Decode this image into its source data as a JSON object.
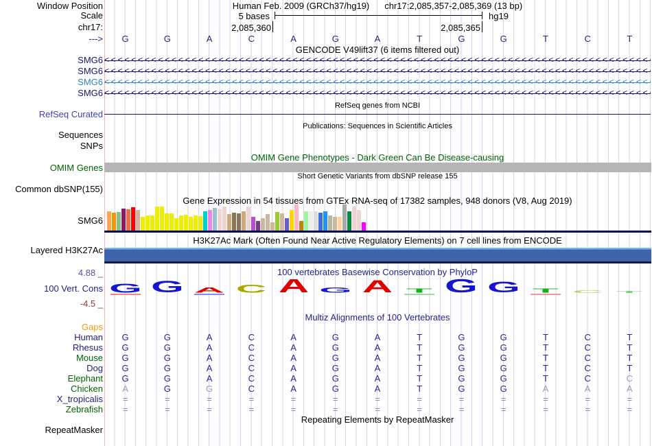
{
  "header": {
    "assembly_title": "Human Feb. 2009 (GRCh37/hg19)",
    "position_title": "chr17:2,085,357-2,085,369 (13 bp)",
    "window_position_label": "Window Position",
    "scale_label": "Scale",
    "scale_value": "5 bases",
    "assembly_tag": "hg19",
    "chrom_label": "chr17:",
    "coord_left": "2,085,360",
    "coord_right": "2,085,365",
    "strand_arrow": "--->"
  },
  "sequence": {
    "bases": [
      "G",
      "G",
      "A",
      "C",
      "A",
      "G",
      "A",
      "T",
      "G",
      "G",
      "T",
      "C",
      "T"
    ],
    "color": "#28286e"
  },
  "tracks": {
    "gencode": {
      "title": "GENCODE V49lift37 (6 items filtered out)",
      "genes": [
        {
          "label": "SMG6",
          "color": "#12126b"
        },
        {
          "label": "SMG6",
          "color": "#12126b"
        },
        {
          "label": "SMG6",
          "color": "#3080c8"
        },
        {
          "label": "SMG6",
          "color": "#12126b"
        }
      ]
    },
    "refseq": {
      "title": "RefSeq genes from NCBI",
      "label": "RefSeq Curated",
      "line_color": "#12126b"
    },
    "publications": {
      "title": "Publications: Sequences in Scientific Articles",
      "label": "Sequences"
    },
    "snps": {
      "label": "SNPs"
    },
    "omim": {
      "title": "OMIM Gene Phenotypes - Dark Green Can Be Disease-causing",
      "label": "OMIM Genes",
      "bar_color": "#b5b5b5"
    },
    "dbsnp": {
      "title": "Short Genetic Variants from dbSNP release 155",
      "label": "Common dbSNP(155)"
    },
    "gtex": {
      "label": "SMG6",
      "baseline_color": "#0a0a50"
    },
    "h3k27ac": {
      "title": "H3K27Ac Mark (Often Found Near Active Regulatory Elements) on 7 cell lines from ENCODE",
      "label": "Layered H3K27Ac",
      "bar_top": "#7fb2ee",
      "bar_body": "#3d64ad",
      "bar_bottom": "#131a45"
    },
    "phylop": {
      "title": "100 vertebrates Basewise Conservation by PhyloP",
      "label": "100 Vert. Cons",
      "max_label": "4.88 _",
      "min_label": "-4.5 _",
      "base_colors": {
        "A": "#e00000",
        "C": "#a8a800",
        "G": "#1515d0",
        "T": "#15b015"
      },
      "logo": [
        {
          "base": "G",
          "h": 13,
          "uline": "#ee8888"
        },
        {
          "base": "G",
          "h": 17
        },
        {
          "base": "A",
          "h": 8,
          "uline": "#8888ee"
        },
        {
          "base": "C",
          "h": 12
        },
        {
          "base": "A",
          "h": 20
        },
        {
          "base": "G",
          "h": 8
        },
        {
          "base": "A",
          "h": 18
        },
        {
          "base": "T",
          "h": 6,
          "uline": "#99dd99"
        },
        {
          "base": "G",
          "h": 20
        },
        {
          "base": "G",
          "h": 16
        },
        {
          "base": "T",
          "h": 6,
          "uline": "#ee9999"
        },
        {
          "base": "C",
          "h": 4,
          "faint": true
        },
        {
          "base": "T",
          "h": 3,
          "faint": true
        }
      ]
    },
    "multiz": {
      "title": "Multiz Alignments of 100 Vertebrates",
      "gaps_label": "Gaps",
      "rows": [
        {
          "species": "Human",
          "label_color": "#1e1e78",
          "bases": [
            "G",
            "G",
            "A",
            "C",
            "A",
            "G",
            "A",
            "T",
            "G",
            "G",
            "T",
            "C",
            "T"
          ],
          "gray": []
        },
        {
          "species": "Rhesus",
          "label_color": "#1e1e78",
          "bases": [
            "G",
            "G",
            "A",
            "C",
            "A",
            "G",
            "A",
            "T",
            "G",
            "G",
            "T",
            "C",
            "T"
          ],
          "gray": []
        },
        {
          "species": "Mouse",
          "label_color": "#006400",
          "bases": [
            "G",
            "G",
            "A",
            "C",
            "A",
            "G",
            "A",
            "T",
            "G",
            "G",
            "T",
            "C",
            "T"
          ],
          "gray": []
        },
        {
          "species": "Dog",
          "label_color": "#1e1e78",
          "bases": [
            "G",
            "G",
            "A",
            "C",
            "A",
            "G",
            "A",
            "T",
            "G",
            "G",
            "T",
            "C",
            "T"
          ],
          "gray": []
        },
        {
          "species": "Elephant",
          "label_color": "#006400",
          "bases": [
            "G",
            "G",
            "A",
            "C",
            "A",
            "G",
            "A",
            "T",
            "G",
            "G",
            "T",
            "C",
            "C"
          ],
          "gray": [
            12
          ]
        },
        {
          "species": "Chicken",
          "label_color": "#006400",
          "bases": [
            "A",
            "G",
            "G",
            "C",
            "A",
            "G",
            "A",
            "T",
            "G",
            "G",
            "A",
            "A",
            "A"
          ],
          "gray": [
            0,
            2,
            10,
            11,
            12
          ]
        },
        {
          "species": "X_tropicalis",
          "label_color": "#1e1e78",
          "bases": [
            "=",
            "=",
            "=",
            "=",
            "=",
            "=",
            "=",
            "=",
            "=",
            "=",
            "=",
            "=",
            "="
          ],
          "gray": "all"
        },
        {
          "species": "Zebrafish",
          "label_color": "#006400",
          "bases": [
            "=",
            "=",
            "=",
            "=",
            "=",
            "=",
            "=",
            "=",
            "=",
            "=",
            "=",
            "=",
            "="
          ],
          "gray": "all"
        }
      ]
    },
    "repeatmasker": {
      "title": "Repeating Elements by RepeatMasker",
      "label": "RepeatMasker"
    }
  },
  "chart_data": {
    "type": "bar",
    "title": "Gene Expression in 54 tissues from GTEx RNA-seq of 17382 samples, 948 donors (V8, Aug 2019)",
    "gene": "SMG6",
    "note": "54 GTEx tissue expression bars left-to-right; values are relative bar heights in pixels (no numeric axis shown in image)",
    "ylim": [
      0,
      41
    ],
    "values": [
      28,
      26,
      27,
      32,
      31,
      34,
      30,
      20,
      22,
      22,
      35,
      35,
      25,
      25,
      18,
      22,
      23,
      20,
      22,
      21,
      28,
      30,
      33,
      31,
      35,
      24,
      26,
      25,
      28,
      35,
      20,
      14,
      18,
      24,
      12,
      27,
      25,
      18,
      30,
      38,
      14,
      28,
      28,
      28,
      26,
      28,
      22,
      20,
      20,
      38,
      28,
      35,
      30,
      12
    ],
    "colors": [
      "#FFA54F",
      "#EE9A00",
      "#8FBC8F",
      "#8B1C62",
      "#EE6A50",
      "#FF0000",
      "#CDB79E",
      "#EEEE00",
      "#EEEE00",
      "#EEEE00",
      "#EEEE00",
      "#EEEE00",
      "#EEEE00",
      "#EEEE00",
      "#EEEE00",
      "#EEEE00",
      "#EEEE00",
      "#EEEE00",
      "#EEEE00",
      "#EEEE00",
      "#00CDCD",
      "#EE82EE",
      "#9AC0CD",
      "#EED5D2",
      "#EED5D2",
      "#CDAA7D",
      "#8B7355",
      "#8B7355",
      "#CDAA7D",
      "#EED5D2",
      "#B452CD",
      "#7A378B",
      "#CDB79E",
      "#CDB79E",
      "#CDB79E",
      "#9ACD32",
      "#CDB79E",
      "#6A5ACD",
      "#FFD700",
      "#FFB6C1",
      "#B8860B",
      "#98FB98",
      "#EEEEEE",
      "#DDDDDD",
      "#4169E1",
      "#1E90FF",
      "#B5B5A0",
      "#CDB79E",
      "#FFD39B",
      "#A9A9A9",
      "#008B45",
      "#EED5D2",
      "#EED5D2",
      "#FF00FF"
    ]
  }
}
